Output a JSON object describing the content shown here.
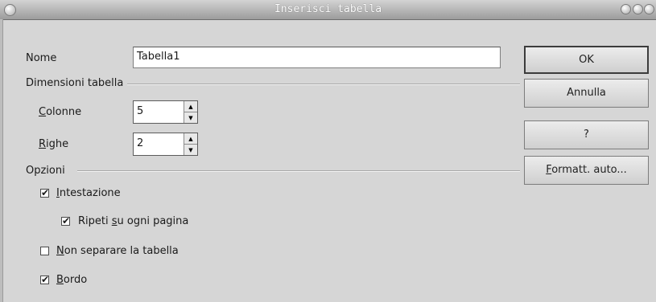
{
  "window": {
    "title": "Inserisci tabella"
  },
  "form": {
    "name_label": "Nome",
    "name_value": "Tabella1",
    "dimensions_label": "Dimensioni tabella",
    "columns_label_underlined": "C",
    "columns_label_rest": "olonne",
    "columns_value": "5",
    "rows_label_underlined": "R",
    "rows_label_rest": "ighe",
    "rows_value": "2",
    "options_label": "Opzioni",
    "options": {
      "heading_underlined": "I",
      "heading_rest": "ntestazione",
      "heading_checked": true,
      "repeat_pre": "Ripeti ",
      "repeat_underlined": "s",
      "repeat_rest": "u ogni pagina",
      "repeat_checked": true,
      "nosplit_underlined": "N",
      "nosplit_rest": "on separare la tabella",
      "nosplit_checked": false,
      "border_underlined": "B",
      "border_rest": "ordo",
      "border_checked": true
    }
  },
  "buttons": {
    "ok": "OK",
    "cancel": "Annulla",
    "help": "?",
    "autoformat_underlined": "F",
    "autoformat_rest": "ormatt. auto..."
  },
  "icons": {
    "check_mark": "✔",
    "up_arrow": "▲",
    "down_arrow": "▼"
  }
}
